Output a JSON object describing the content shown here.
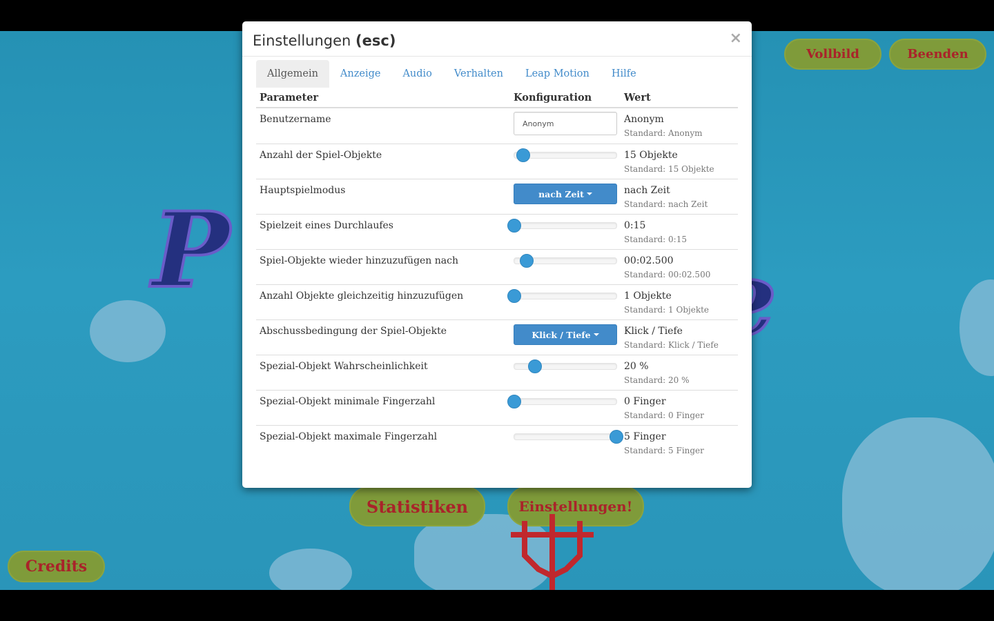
{
  "game": {
    "buttons": {
      "fullscreen": "Vollbild",
      "quit": "Beenden",
      "statistics": "Statistiken",
      "settings": "Einstellungen!",
      "credits": "Credits"
    },
    "title_left": "P",
    "title_right": "e"
  },
  "modal": {
    "title": "Einstellungen ",
    "title_bold": "(esc)",
    "close": "×",
    "tabs": [
      "Allgemein",
      "Anzeige",
      "Audio",
      "Verhalten",
      "Leap Motion",
      "Hilfe"
    ],
    "active_tab": "Allgemein",
    "columns": {
      "param": "Parameter",
      "config": "Konfiguration",
      "value": "Wert"
    },
    "rows": [
      {
        "name": "Benutzername",
        "control": "text",
        "input": "Anonym",
        "value": "Anonym",
        "standard": "Standard: Anonym"
      },
      {
        "name": "Anzahl der Spiel-Objekte",
        "control": "slider",
        "level": 0.09,
        "value": "15 Objekte",
        "standard": "Standard: 15 Objekte"
      },
      {
        "name": "Hauptspielmodus",
        "control": "dropdown",
        "selected": "nach Zeit",
        "value": "nach Zeit",
        "standard": "Standard: nach Zeit"
      },
      {
        "name": "Spielzeit eines Durchlaufes",
        "control": "slider",
        "level": 0.0,
        "value": "0:15",
        "standard": "Standard: 0:15"
      },
      {
        "name": "Spiel-Objekte wieder hinzuzufügen nach",
        "control": "slider",
        "level": 0.12,
        "value": "00:02.500",
        "standard": "Standard: 00:02.500"
      },
      {
        "name": "Anzahl Objekte gleichzeitig hinzuzufügen",
        "control": "slider",
        "level": 0.0,
        "value": "1 Objekte",
        "standard": "Standard: 1 Objekte"
      },
      {
        "name": "Abschussbedingung der Spiel-Objekte",
        "control": "dropdown",
        "selected": "Klick / Tiefe",
        "value": "Klick / Tiefe",
        "standard": "Standard: Klick / Tiefe"
      },
      {
        "name": "Spezial-Objekt Wahrscheinlichkeit",
        "control": "slider",
        "level": 0.2,
        "value": "20 %",
        "standard": "Standard: 20 %"
      },
      {
        "name": "Spezial-Objekt minimale Fingerzahl",
        "control": "slider",
        "level": 0.0,
        "value": "0 Finger",
        "standard": "Standard: 0 Finger"
      },
      {
        "name": "Spezial-Objekt maximale Fingerzahl",
        "control": "slider",
        "level": 1.0,
        "value": "5 Finger",
        "standard": "Standard: 5 Finger"
      }
    ]
  },
  "colors": {
    "accent": "#428bca",
    "slider_knob": "#3a9ad6",
    "game_bg": "#2a95b9",
    "game_button": "#7f9b3a",
    "game_button_text": "#a9232a"
  }
}
